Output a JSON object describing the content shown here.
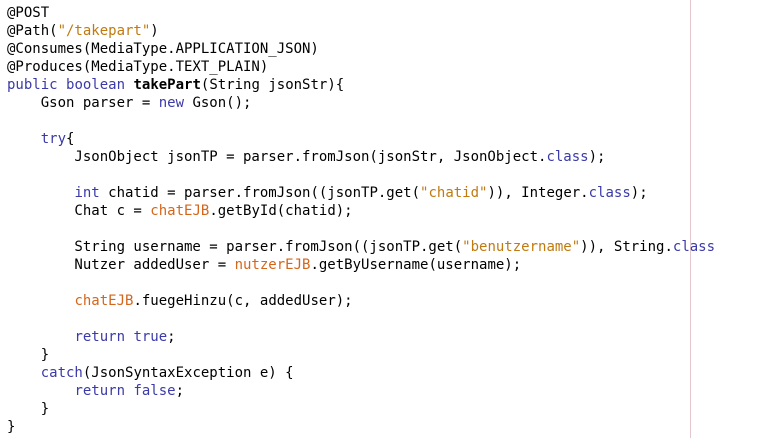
{
  "colors": {
    "keyword": "#3a3aa8",
    "string": "#c07a10",
    "field": "#d4661a",
    "text": "#000000",
    "margin": "#e3c9cf",
    "background": "#ffffff"
  },
  "lines": [
    [
      {
        "t": "@POST",
        "c": ""
      }
    ],
    [
      {
        "t": "@Path(",
        "c": ""
      },
      {
        "t": "\"/takepart\"",
        "c": "str"
      },
      {
        "t": ")",
        "c": ""
      }
    ],
    [
      {
        "t": "@Consumes(MediaType.APPLICATION_JSON)",
        "c": ""
      }
    ],
    [
      {
        "t": "@Produces(MediaType.TEXT_PLAIN)",
        "c": ""
      }
    ],
    [
      {
        "t": "public",
        "c": "kw"
      },
      {
        "t": " ",
        "c": ""
      },
      {
        "t": "boolean",
        "c": "kw"
      },
      {
        "t": " ",
        "c": ""
      },
      {
        "t": "takePart",
        "c": "bold"
      },
      {
        "t": "(String jsonStr){",
        "c": ""
      }
    ],
    [
      {
        "t": "    Gson parser = ",
        "c": ""
      },
      {
        "t": "new",
        "c": "kw"
      },
      {
        "t": " Gson();",
        "c": ""
      }
    ],
    [
      {
        "t": "",
        "c": ""
      }
    ],
    [
      {
        "t": "    ",
        "c": ""
      },
      {
        "t": "try",
        "c": "kw"
      },
      {
        "t": "{",
        "c": ""
      }
    ],
    [
      {
        "t": "        JsonObject jsonTP = parser.fromJson(jsonStr, JsonObject.",
        "c": ""
      },
      {
        "t": "class",
        "c": "kw"
      },
      {
        "t": ");",
        "c": ""
      }
    ],
    [
      {
        "t": "",
        "c": ""
      }
    ],
    [
      {
        "t": "        ",
        "c": ""
      },
      {
        "t": "int",
        "c": "kw"
      },
      {
        "t": " chatid = parser.fromJson((jsonTP.get(",
        "c": ""
      },
      {
        "t": "\"chatid\"",
        "c": "str"
      },
      {
        "t": ")), Integer.",
        "c": ""
      },
      {
        "t": "class",
        "c": "kw"
      },
      {
        "t": ");",
        "c": ""
      }
    ],
    [
      {
        "t": "        Chat c = ",
        "c": ""
      },
      {
        "t": "chatEJB",
        "c": "fld"
      },
      {
        "t": ".getById(chatid);",
        "c": ""
      }
    ],
    [
      {
        "t": "",
        "c": ""
      }
    ],
    [
      {
        "t": "        String username = parser.fromJson((jsonTP.get(",
        "c": ""
      },
      {
        "t": "\"benutzername\"",
        "c": "str"
      },
      {
        "t": ")), String.",
        "c": ""
      },
      {
        "t": "class",
        "c": "kw"
      }
    ],
    [
      {
        "t": "        Nutzer addedUser = ",
        "c": ""
      },
      {
        "t": "nutzerEJB",
        "c": "fld"
      },
      {
        "t": ".getByUsername(username);",
        "c": ""
      }
    ],
    [
      {
        "t": "",
        "c": ""
      }
    ],
    [
      {
        "t": "        ",
        "c": ""
      },
      {
        "t": "chatEJB",
        "c": "fld"
      },
      {
        "t": ".fuegeHinzu(c, addedUser);",
        "c": ""
      }
    ],
    [
      {
        "t": "",
        "c": ""
      }
    ],
    [
      {
        "t": "        ",
        "c": ""
      },
      {
        "t": "return",
        "c": "kw"
      },
      {
        "t": " ",
        "c": ""
      },
      {
        "t": "true",
        "c": "kw"
      },
      {
        "t": ";",
        "c": ""
      }
    ],
    [
      {
        "t": "    }",
        "c": ""
      }
    ],
    [
      {
        "t": "    ",
        "c": ""
      },
      {
        "t": "catch",
        "c": "kw"
      },
      {
        "t": "(JsonSyntaxException e) {",
        "c": ""
      }
    ],
    [
      {
        "t": "        ",
        "c": ""
      },
      {
        "t": "return",
        "c": "kw"
      },
      {
        "t": " ",
        "c": ""
      },
      {
        "t": "false",
        "c": "kw"
      },
      {
        "t": ";",
        "c": ""
      }
    ],
    [
      {
        "t": "    }",
        "c": ""
      }
    ],
    [
      {
        "t": "}",
        "c": ""
      }
    ]
  ]
}
